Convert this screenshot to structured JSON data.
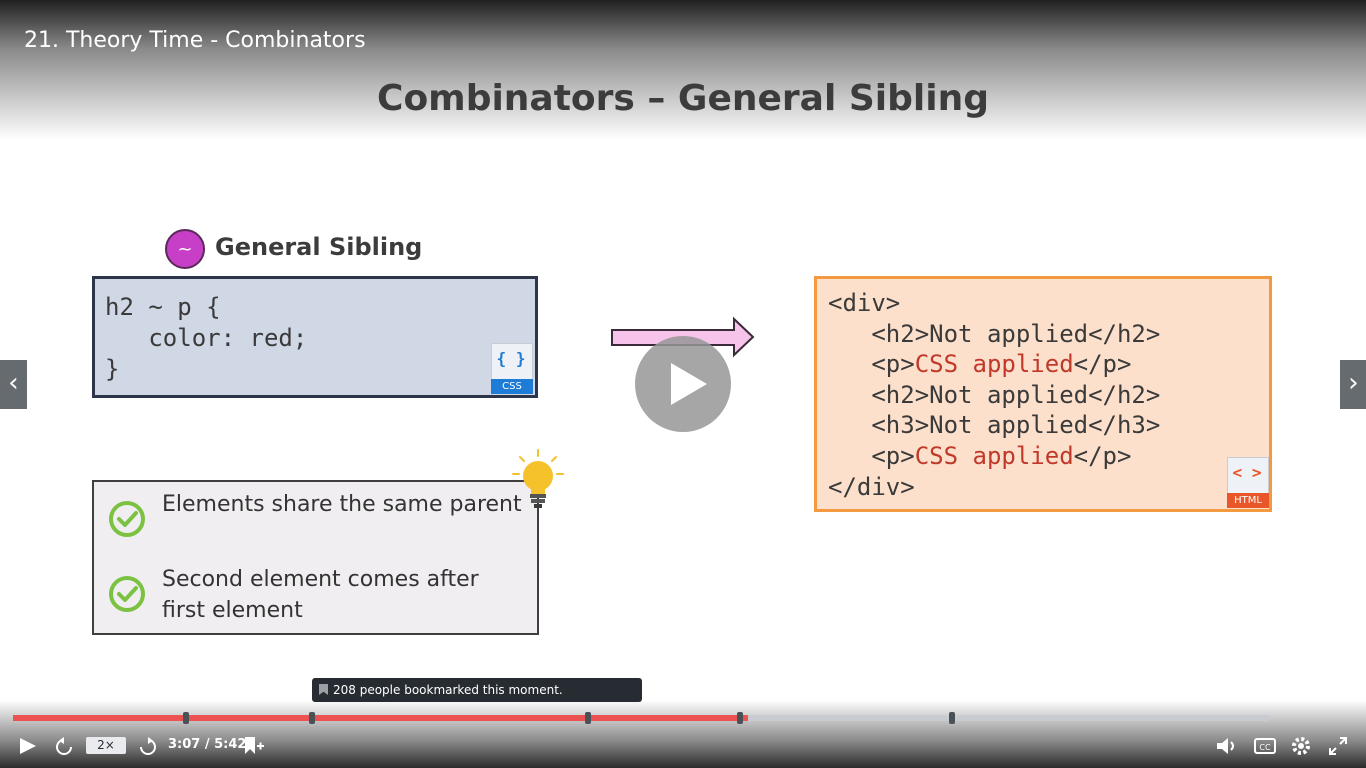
{
  "video": {
    "title": "21. Theory Time - Combinators"
  },
  "slide": {
    "heading": "Combinators – General Sibling",
    "selector_badge": {
      "symbol": "~",
      "label": "General Sibling"
    },
    "css_code": {
      "lines": [
        "h2 ~ p {",
        "   color: red;",
        "}"
      ],
      "file_tag": "CSS",
      "file_glyph": "{ }"
    },
    "html_code": {
      "lines": [
        {
          "pre": "<div>",
          "hl": "",
          "post": ""
        },
        {
          "pre": "   <h2>Not applied</h2>",
          "hl": "",
          "post": ""
        },
        {
          "pre": "   <p>",
          "hl": "CSS applied",
          "post": "</p>"
        },
        {
          "pre": "   <h2>Not applied</h2>",
          "hl": "",
          "post": ""
        },
        {
          "pre": "   <h3>Not applied</h3>",
          "hl": "",
          "post": ""
        },
        {
          "pre": "   <p>",
          "hl": "CSS applied",
          "post": "</p>"
        },
        {
          "pre": "</div>",
          "hl": "",
          "post": ""
        }
      ],
      "file_tag": "HTML",
      "file_glyph": "< >"
    },
    "rules": [
      "Elements share the same parent",
      "Second element comes after first element"
    ]
  },
  "player": {
    "bookmark_tooltip": "208 people bookmarked this moment.",
    "speed": "2×",
    "time": "3:07 / 5:42",
    "progress_fraction": 0.5851,
    "bookmark_marker_fractions": [
      0.1374,
      0.2381,
      0.4578,
      0.5787,
      0.7478
    ],
    "accent_color": "#ec5252",
    "icons": [
      "play-icon",
      "rewind-icon",
      "forward-icon",
      "bookmark-add-icon",
      "volume-icon",
      "captions-icon",
      "settings-icon",
      "fullscreen-icon"
    ]
  },
  "navigation": {
    "prev_icon": "chevron-left-icon",
    "next_icon": "chevron-right-icon"
  }
}
